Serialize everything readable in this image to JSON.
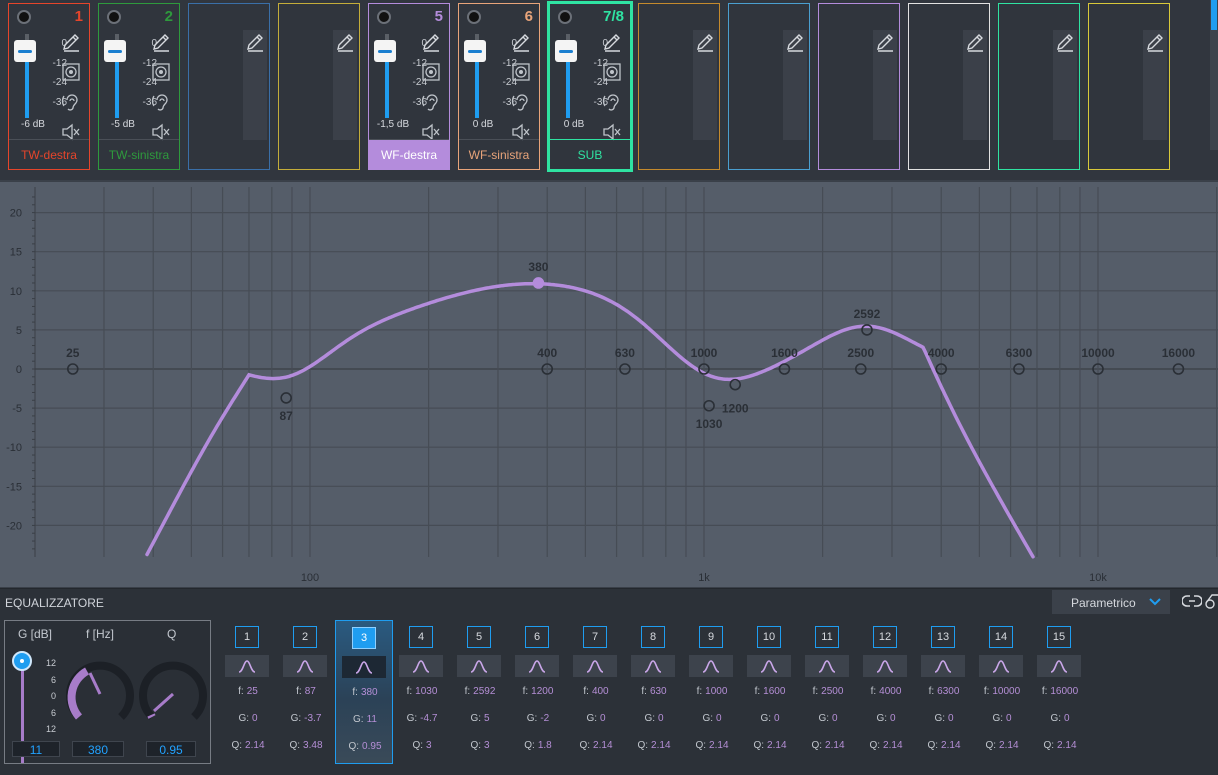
{
  "channels": [
    {
      "num": "1",
      "name": "TW-destra",
      "db": "-6 dB",
      "color": "#e5452b",
      "fill": 0.85,
      "has_fader": true,
      "name_bg": "",
      "selected": false
    },
    {
      "num": "2",
      "name": "TW-sinistra",
      "db": "-5 dB",
      "color": "#2e9a3d",
      "fill": 0.85,
      "has_fader": true,
      "name_bg": "",
      "selected": false
    },
    {
      "num": "",
      "name": "",
      "db": "",
      "color": "#3a6fa8",
      "has_fader": false,
      "selected": false
    },
    {
      "num": "",
      "name": "",
      "db": "",
      "color": "#c4ad3a",
      "has_fader": false,
      "selected": false
    },
    {
      "num": "5",
      "name": "WF-destra",
      "db": "-1,5 dB",
      "color": "#b48cdc",
      "fill": 0.85,
      "has_fader": true,
      "name_bg": "#b48cdc",
      "selected": false
    },
    {
      "num": "6",
      "name": "WF-sinistra",
      "db": "0 dB",
      "color": "#e8a47a",
      "fill": 0.85,
      "has_fader": true,
      "name_bg": "",
      "selected": false
    },
    {
      "num": "7/8",
      "name": "SUB",
      "db": "0 dB",
      "color": "#2fe3a2",
      "fill": 0.85,
      "has_fader": true,
      "name_bg": "",
      "selected": true
    },
    {
      "num": "",
      "name": "",
      "db": "",
      "color": "#c48a2d",
      "has_fader": false,
      "selected": false
    },
    {
      "num": "",
      "name": "",
      "db": "",
      "color": "#4a9fd0",
      "has_fader": false,
      "selected": false
    },
    {
      "num": "",
      "name": "",
      "db": "",
      "color": "#b48cdc",
      "has_fader": false,
      "selected": false
    },
    {
      "num": "",
      "name": "",
      "db": "",
      "color": "#e2e2e2",
      "has_fader": false,
      "selected": false
    },
    {
      "num": "",
      "name": "",
      "db": "",
      "color": "#2fe3a2",
      "has_fader": false,
      "selected": false
    },
    {
      "num": "",
      "name": "",
      "db": "",
      "color": "#d8c83a",
      "has_fader": false,
      "selected": false
    }
  ],
  "fader_scale": [
    "0",
    "-12",
    "-24",
    "-36"
  ],
  "graph": {
    "y_ticks": [
      "20",
      "15",
      "10",
      "5",
      "0",
      "-5",
      "-10",
      "-15",
      "-20"
    ],
    "x_ticks": [
      "100",
      "1k",
      "10k"
    ],
    "curve_color": "#b48cdc",
    "points": [
      {
        "label": "25",
        "f": 25,
        "g": 0,
        "label_pos": "above"
      },
      {
        "label": "87",
        "f": 87,
        "g": -3.7,
        "label_pos": "below"
      },
      {
        "label": "380",
        "f": 380,
        "g": 11,
        "label_pos": "above",
        "active": true
      },
      {
        "label": "400",
        "f": 400,
        "g": 0,
        "label_pos": "above"
      },
      {
        "label": "630",
        "f": 630,
        "g": 0,
        "label_pos": "above"
      },
      {
        "label": "1000",
        "f": 1000,
        "g": 0,
        "label_pos": "above"
      },
      {
        "label": "1030",
        "f": 1030,
        "g": -4.7,
        "label_pos": "below"
      },
      {
        "label": "1200",
        "f": 1200,
        "g": -2,
        "label_pos": "below-right"
      },
      {
        "label": "1600",
        "f": 1600,
        "g": 0,
        "label_pos": "above"
      },
      {
        "label": "2500",
        "f": 2500,
        "g": 0,
        "label_pos": "above"
      },
      {
        "label": "2592",
        "f": 2592,
        "g": 5,
        "label_pos": "above"
      },
      {
        "label": "4000",
        "f": 4000,
        "g": 0,
        "label_pos": "above"
      },
      {
        "label": "6300",
        "f": 6300,
        "g": 0,
        "label_pos": "above"
      },
      {
        "label": "10000",
        "f": 10000,
        "g": 0,
        "label_pos": "above"
      },
      {
        "label": "16000",
        "f": 16000,
        "g": 0,
        "label_pos": "above"
      }
    ]
  },
  "eq": {
    "title": "EQUALIZZATORE",
    "mode": "Parametrico",
    "g_label": "G [dB]",
    "f_label": "f [Hz]",
    "q_label": "Q",
    "g_scale": [
      "12",
      "6",
      "0",
      "6",
      "12"
    ],
    "g_value": "11",
    "f_value": "380",
    "q_value": "0.95",
    "row_labels": {
      "f": "f:",
      "g": "G:",
      "q": "Q:"
    },
    "bands": [
      {
        "n": "1",
        "f": "25",
        "g": "0",
        "q": "2.14"
      },
      {
        "n": "2",
        "f": "87",
        "g": "-3.7",
        "q": "3.48"
      },
      {
        "n": "3",
        "f": "380",
        "g": "11",
        "q": "0.95",
        "selected": true
      },
      {
        "n": "4",
        "f": "1030",
        "g": "-4.7",
        "q": "3"
      },
      {
        "n": "5",
        "f": "2592",
        "g": "5",
        "q": "3"
      },
      {
        "n": "6",
        "f": "1200",
        "g": "-2",
        "q": "1.8"
      },
      {
        "n": "7",
        "f": "400",
        "g": "0",
        "q": "2.14"
      },
      {
        "n": "8",
        "f": "630",
        "g": "0",
        "q": "2.14"
      },
      {
        "n": "9",
        "f": "1000",
        "g": "0",
        "q": "2.14"
      },
      {
        "n": "10",
        "f": "1600",
        "g": "0",
        "q": "2.14"
      },
      {
        "n": "11",
        "f": "2500",
        "g": "0",
        "q": "2.14"
      },
      {
        "n": "12",
        "f": "4000",
        "g": "0",
        "q": "2.14"
      },
      {
        "n": "13",
        "f": "6300",
        "g": "0",
        "q": "2.14"
      },
      {
        "n": "14",
        "f": "10000",
        "g": "0",
        "q": "2.14"
      },
      {
        "n": "15",
        "f": "16000",
        "g": "0",
        "q": "2.14"
      }
    ]
  }
}
